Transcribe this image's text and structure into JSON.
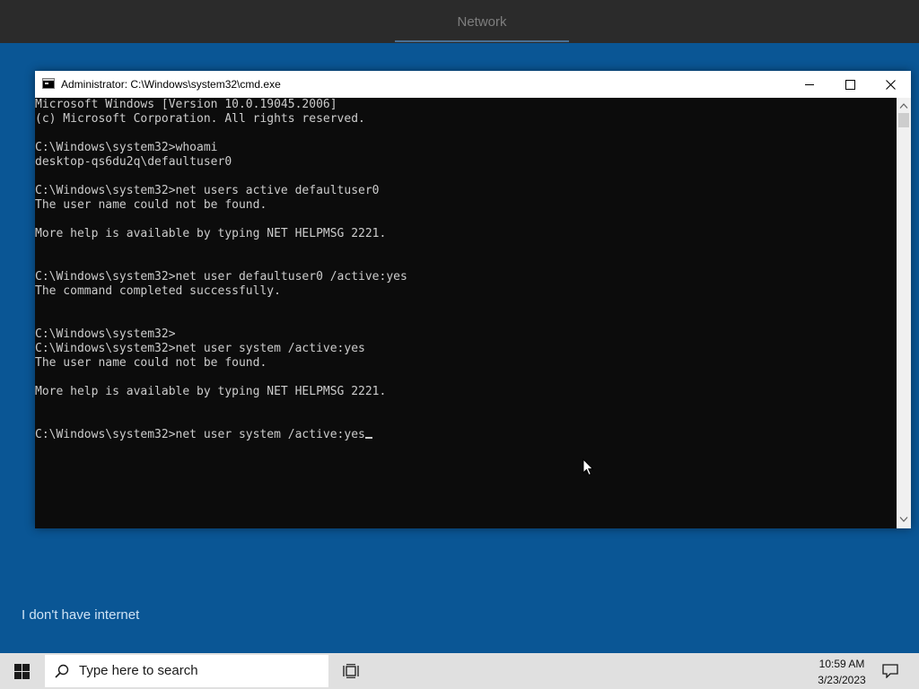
{
  "oobe": {
    "header_title": "Network",
    "no_internet_link": "I don't have internet"
  },
  "cmd_window": {
    "title": "Administrator: C:\\Windows\\system32\\cmd.exe",
    "console_lines": [
      "Microsoft Windows [Version 10.0.19045.2006]",
      "(c) Microsoft Corporation. All rights reserved.",
      "",
      "C:\\Windows\\system32>whoami",
      "desktop-qs6du2q\\defaultuser0",
      "",
      "C:\\Windows\\system32>net users active defaultuser0",
      "The user name could not be found.",
      "",
      "More help is available by typing NET HELPMSG 2221.",
      "",
      "",
      "C:\\Windows\\system32>net user defaultuser0 /active:yes",
      "The command completed successfully.",
      "",
      "",
      "C:\\Windows\\system32>",
      "C:\\Windows\\system32>net user system /active:yes",
      "The user name could not be found.",
      "",
      "More help is available by typing NET HELPMSG 2221.",
      "",
      "",
      "C:\\Windows\\system32>net user system /active:yes"
    ],
    "colors": {
      "console_background": "#0c0c0c",
      "console_text": "#cccccc"
    }
  },
  "taskbar": {
    "search_placeholder": "Type here to search",
    "clock_time": "10:59 AM",
    "clock_date": "3/23/2023",
    "icons": {
      "start": "windows-logo-icon",
      "search": "search-icon",
      "task_view": "task-view-icon",
      "notifications": "notification-icon"
    }
  },
  "colors": {
    "desktop_background": "#0a5695",
    "header_background": "#2b2b2b",
    "taskbar_background": "#e0e0e0"
  }
}
